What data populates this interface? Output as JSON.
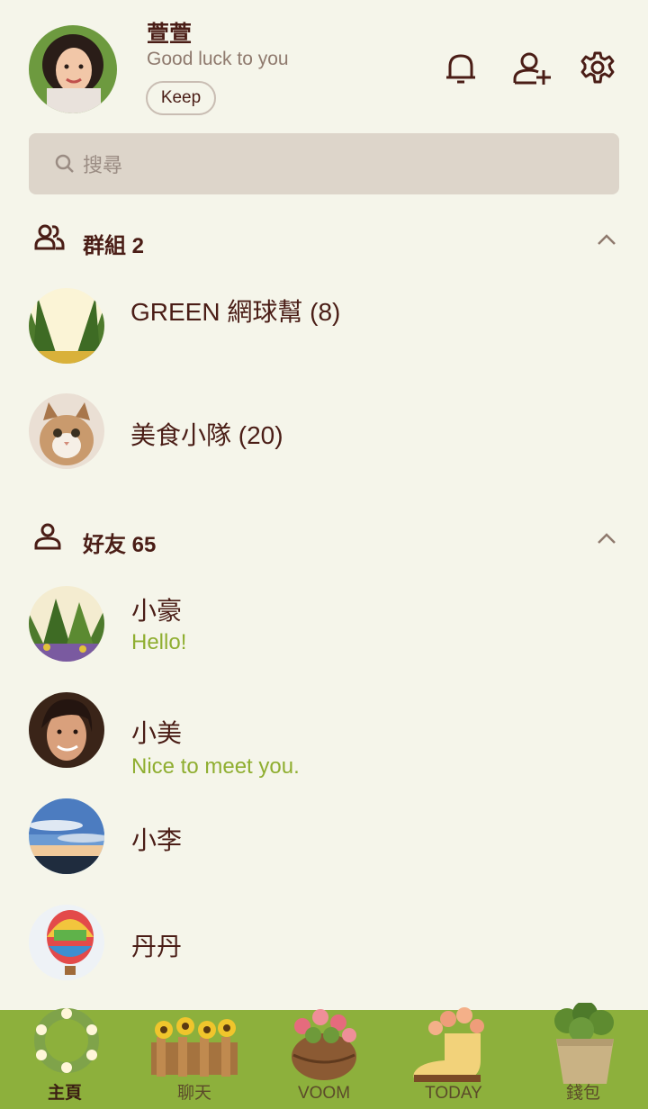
{
  "profile": {
    "name": "萱萱",
    "status": "Good luck to you",
    "keep_label": "Keep"
  },
  "search": {
    "placeholder": "搜尋"
  },
  "groups": {
    "title": "群組 2",
    "items": [
      {
        "name": "GREEN 網球幫 (8)"
      },
      {
        "name": "美食小隊 (20)"
      }
    ]
  },
  "friends": {
    "title": "好友 65",
    "items": [
      {
        "name": "小豪",
        "message": "Hello!"
      },
      {
        "name": "小美",
        "message": "Nice to meet you."
      },
      {
        "name": "小李"
      },
      {
        "name": "丹丹"
      }
    ]
  },
  "tabs": [
    {
      "label": "主頁",
      "active": true
    },
    {
      "label": "聊天"
    },
    {
      "label": "VOOM"
    },
    {
      "label": "TODAY"
    },
    {
      "label": "錢包"
    }
  ],
  "colors": {
    "background": "#f5f5ea",
    "text": "#4a1d16",
    "accent_green": "#8fae30",
    "tabbar": "#8db03c",
    "search_bg": "#ddd5ca"
  }
}
